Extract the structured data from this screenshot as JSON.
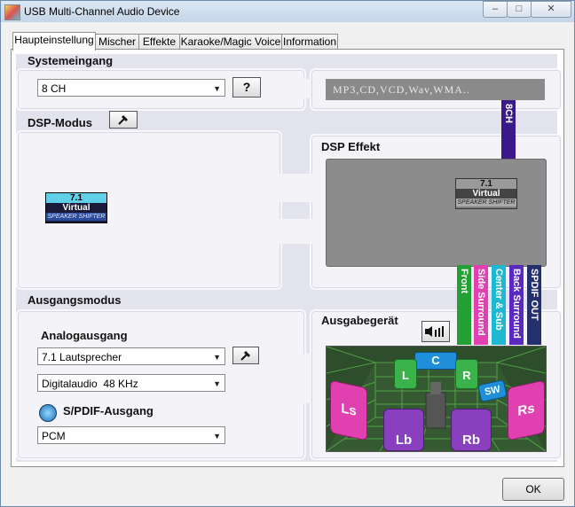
{
  "window": {
    "title": "USB Multi-Channel Audio Device"
  },
  "title_buttons": {
    "minimize": "–",
    "maximize": "□",
    "close": "✕"
  },
  "tabs": [
    "Haupteinstellung",
    "Mischer",
    "Effekte",
    "Karaoke/Magic Voice",
    "Information"
  ],
  "systemeingang": {
    "label": "Systemeingang",
    "select_value": "8 CH",
    "help_label": "?",
    "formats": "MP3,CD,VCD,Wav,WMA.."
  },
  "dsp": {
    "label": "DSP-Modus",
    "effect_label": "DSP Effekt"
  },
  "badge": {
    "line1": "7.1",
    "line2": "Virtual",
    "line3": "SPEAKER SHIFTER"
  },
  "channel_bars": {
    "top": "8CH",
    "bars": [
      "Front",
      "Side Surround",
      "Center & Sub",
      "Back Surround",
      "SPDIF OUT"
    ]
  },
  "ausgang": {
    "label": "Ausgangsmodus",
    "analog_label": "Analogausgang",
    "speaker_select": "7.1 Lautsprecher",
    "digital_select": "Digitalaudio  48 KHz",
    "spdif_label": "S/PDIF-Ausgang",
    "spdif_select": "PCM"
  },
  "ausgabe": {
    "label": "Ausgabegerät"
  },
  "speakers": {
    "c": "C",
    "l": "L",
    "r": "R",
    "sw": "SW",
    "ls": "Ls",
    "rs": "Rs",
    "lb": "Lb",
    "rb": "Rb"
  },
  "footer": {
    "ok": "OK"
  },
  "colors": {
    "front": "#22a033",
    "side": "#e040b0",
    "center": "#1fb8d0",
    "back": "#5a2ac0",
    "spdif": "#24306e",
    "eightch": "#3a1a8a"
  }
}
